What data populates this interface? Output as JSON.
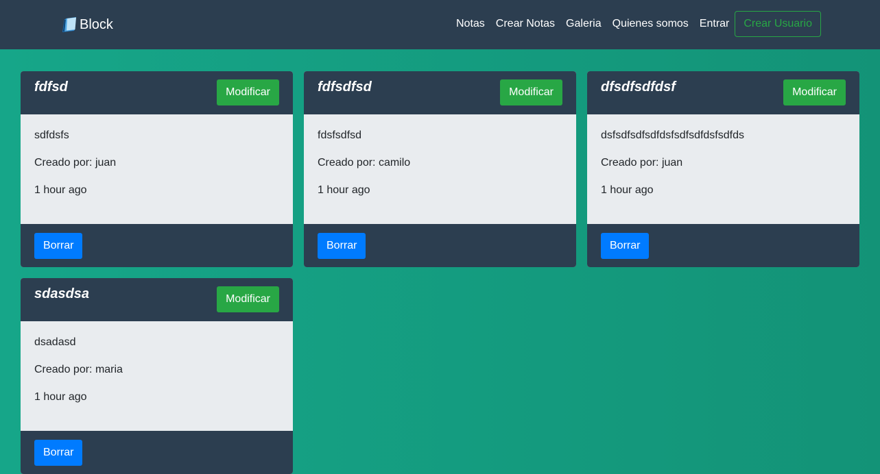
{
  "navbar": {
    "brand": "Block",
    "links": [
      "Notas",
      "Crear Notas",
      "Galeria",
      "Quienes somos",
      "Entrar"
    ],
    "cta": "Crear Usuario"
  },
  "notes": [
    {
      "title": "fdfsd",
      "content": "sdfdsfs",
      "author": "Creado por: juan",
      "time": "1 hour ago",
      "edit_label": "Modificar",
      "delete_label": "Borrar"
    },
    {
      "title": "fdfsdfsd",
      "content": "fdsfsdfsd",
      "author": "Creado por: camilo",
      "time": "1 hour ago",
      "edit_label": "Modificar",
      "delete_label": "Borrar"
    },
    {
      "title": "dfsdfsdfdsf",
      "content": "dsfsdfsdfsdfdsfsdfsdfdsfsdfds",
      "author": "Creado por: juan",
      "time": "1 hour ago",
      "edit_label": "Modificar",
      "delete_label": "Borrar"
    },
    {
      "title": "sdasdsa",
      "content": "dsadasd",
      "author": "Creado por: maria",
      "time": "1 hour ago",
      "edit_label": "Modificar",
      "delete_label": "Borrar"
    }
  ],
  "colors": {
    "navbar_bg": "#2c3e50",
    "page_bg": "#16a689",
    "success": "#28a745",
    "primary": "#007bff",
    "card_body": "#e9ecef"
  },
  "icons": {
    "brand": "notebook-icon"
  }
}
